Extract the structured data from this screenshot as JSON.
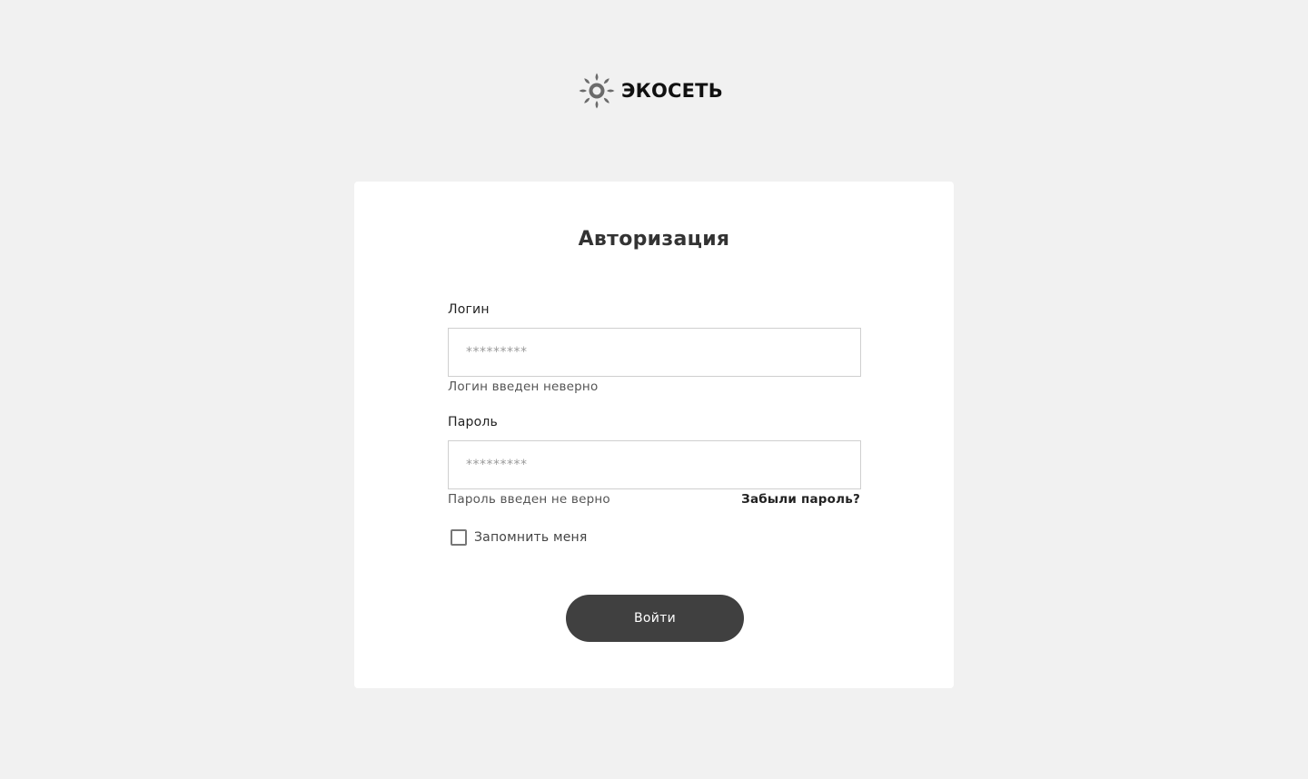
{
  "brand": {
    "logo_icon": "sun-leaf-icon",
    "name": "ЭКОСЕТЬ",
    "logo_color": "#6b6b6b"
  },
  "form": {
    "title": "Авторизация",
    "login": {
      "label": "Логин",
      "value": "",
      "placeholder": "*********",
      "error": "Логин введен неверно"
    },
    "password": {
      "label": "Пароль",
      "value": "",
      "placeholder": "*********",
      "error": "Пароль введен не верно",
      "forgot_link": "Забыли пароль?"
    },
    "remember": {
      "label": "Запомнить меня",
      "checked": false
    },
    "submit_label": "Войти"
  },
  "colors": {
    "page_background": "#f1f1f1",
    "card_background": "#ffffff",
    "button_background": "#404040",
    "button_text": "#ffffff"
  }
}
